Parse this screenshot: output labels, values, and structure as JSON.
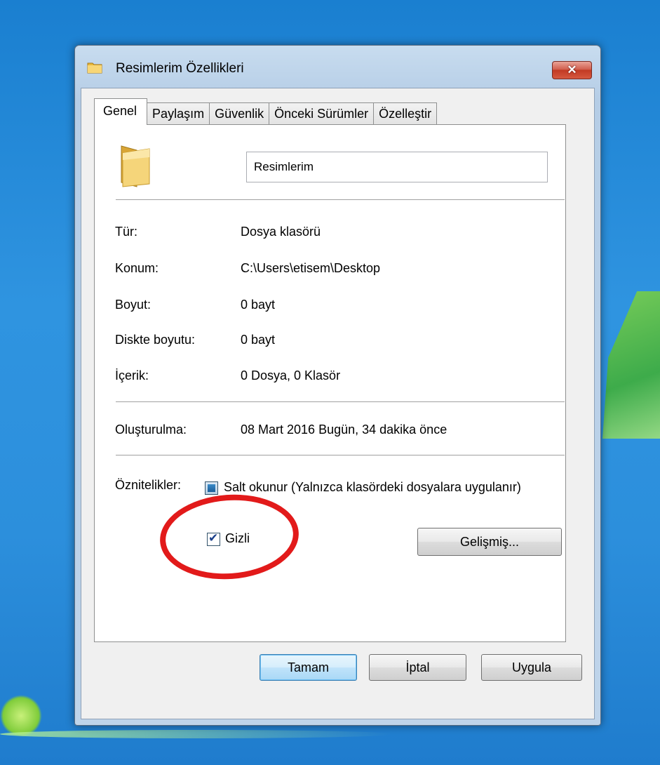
{
  "window": {
    "title": "Resimlerim Özellikleri",
    "close_glyph": "✕"
  },
  "tabs": [
    {
      "label": "Genel",
      "active": true
    },
    {
      "label": "Paylaşım",
      "active": false
    },
    {
      "label": "Güvenlik",
      "active": false
    },
    {
      "label": "Önceki Sürümler",
      "active": false
    },
    {
      "label": "Özelleştir",
      "active": false
    }
  ],
  "folder": {
    "name": "Resimlerim",
    "icon": "folder-icon"
  },
  "properties": {
    "type_label": "Tür:",
    "type_value": "Dosya klasörü",
    "location_label": "Konum:",
    "location_value": "C:\\Users\\etisem\\Desktop",
    "size_label": "Boyut:",
    "size_value": "0 bayt",
    "disk_size_label": "Diskte boyutu:",
    "disk_size_value": "0 bayt",
    "contents_label": "İçerik:",
    "contents_value": "0 Dosya, 0 Klasör",
    "created_label": "Oluşturulma:",
    "created_value": "08 Mart 2016 Bugün, 34 dakika önce"
  },
  "attributes": {
    "label": "Öznitelikler:",
    "readonly_label": "Salt okunur (Yalnızca klasördeki dosyalara uygulanır)",
    "readonly_state": "indeterminate",
    "hidden_label": "Gizli",
    "hidden_checked": true,
    "advanced_button": "Gelişmiş..."
  },
  "footer": {
    "ok": "Tamam",
    "cancel": "İptal",
    "apply": "Uygula"
  },
  "colors": {
    "annotation": "#e21a1a",
    "desktop": "#2f94e0"
  }
}
